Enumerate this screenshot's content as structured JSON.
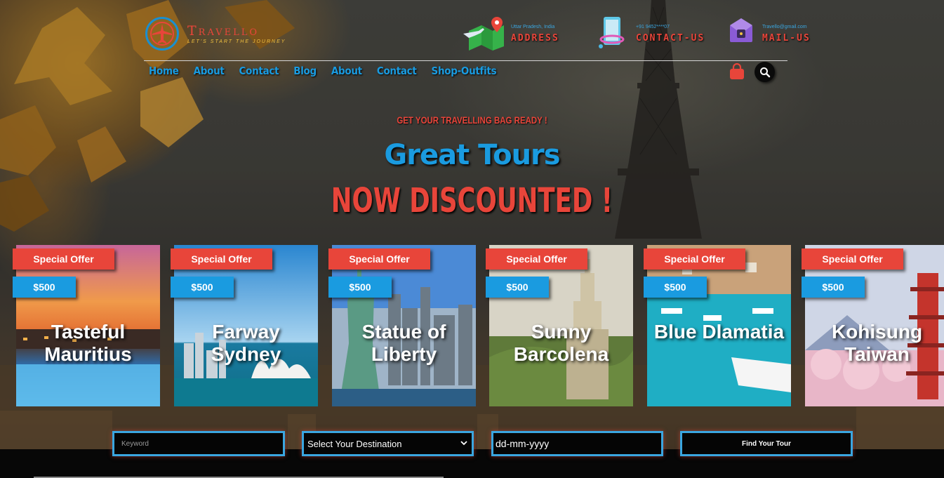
{
  "brand": {
    "name": "Travello",
    "tagline": "LET'S START THE JOURNEY"
  },
  "contacts": [
    {
      "small": "Uttar Pradesh, India",
      "big": "ADDRESS",
      "icon": "map-pin-icon"
    },
    {
      "small": "+91 9452****07",
      "big": "CONTACT-US",
      "icon": "phone-icon"
    },
    {
      "small": "Travello@gmail.com",
      "big": "MAIL-US",
      "icon": "mail-icon"
    }
  ],
  "nav": [
    "Home",
    "About",
    "Contact",
    "Blog",
    "About",
    "Contact",
    "Shop-Outfits"
  ],
  "hero": {
    "kicker": "GET YOUR TRAVELLING BAG READY !",
    "headline": "Great Tours",
    "sub": "NOW DISCOUNTED !"
  },
  "cards": [
    {
      "offer": "Special Offer",
      "price": "$500",
      "name": "Tasteful Mauritius"
    },
    {
      "offer": "Special Offer",
      "price": "$500",
      "name": "Farway Sydney"
    },
    {
      "offer": "Special Offer",
      "price": "$500",
      "name": "Statue of Liberty"
    },
    {
      "offer": "Special Offer",
      "price": "$500",
      "name": "Sunny Barcolena"
    },
    {
      "offer": "Special Offer",
      "price": "$500",
      "name": "Blue Dlamatia"
    },
    {
      "offer": "Special Offer",
      "price": "$500",
      "name": "Kohisung Taiwan"
    }
  ],
  "search": {
    "keyword_placeholder": "Keyword",
    "destination_selected": "Select Your Destination",
    "date_placeholder": "dd-mm-yyyy",
    "button_label": "Find Your Tour"
  },
  "colors": {
    "accent_red": "#e8453a",
    "accent_blue": "#1a9be0"
  }
}
